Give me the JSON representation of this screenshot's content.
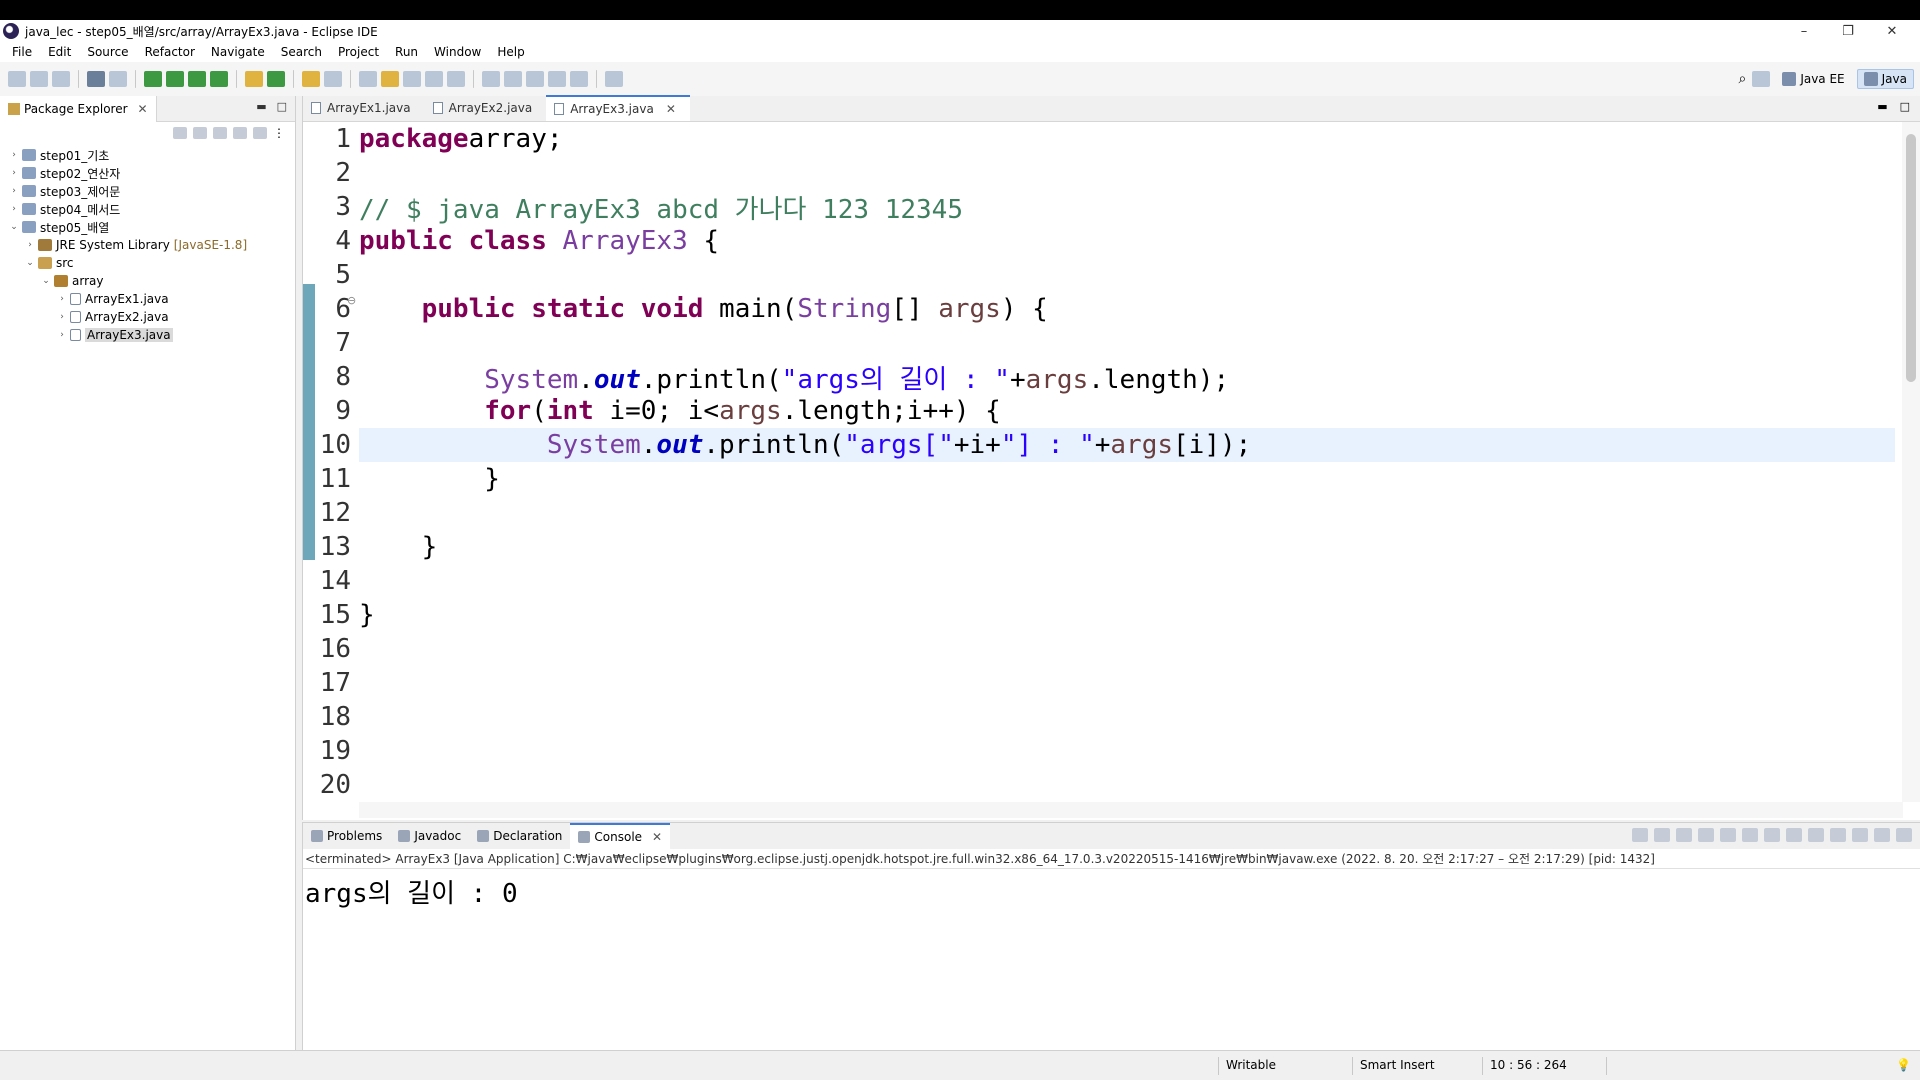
{
  "window": {
    "title": "java_lec - step05_배열/src/array/ArrayEx3.java - Eclipse IDE",
    "minimize": "–",
    "restore": "❐",
    "close": "✕"
  },
  "menu": [
    "File",
    "Edit",
    "Source",
    "Refactor",
    "Navigate",
    "Search",
    "Project",
    "Run",
    "Window",
    "Help"
  ],
  "perspectives": [
    {
      "label": "Java EE",
      "active": false
    },
    {
      "label": "Java",
      "active": true
    }
  ],
  "package_explorer": {
    "title": "Package Explorer",
    "close": "✕",
    "minimize": "▬",
    "maximize": "□",
    "tree": [
      {
        "label": "step01_기초",
        "arrow": "›",
        "icon": "project-icon",
        "indent": 0
      },
      {
        "label": "step02_연산자",
        "arrow": "›",
        "icon": "project-icon",
        "indent": 0
      },
      {
        "label": "step03_제어문",
        "arrow": "›",
        "icon": "project-icon",
        "indent": 0
      },
      {
        "label": "step04_메서드",
        "arrow": "›",
        "icon": "project-icon",
        "indent": 0
      },
      {
        "label": "step05_배열",
        "arrow": "⌄",
        "icon": "project-icon",
        "indent": 0
      },
      {
        "label": "JRE System Library",
        "deco": "[JavaSE-1.8]",
        "arrow": "›",
        "icon": "library-icon",
        "indent": 1
      },
      {
        "label": "src",
        "arrow": "⌄",
        "icon": "source-folder-icon",
        "indent": 1
      },
      {
        "label": "array",
        "arrow": "⌄",
        "icon": "package-icon",
        "indent": 2
      },
      {
        "label": "ArrayEx1.java",
        "arrow": "›",
        "icon": "java-file-icon",
        "indent": 3
      },
      {
        "label": "ArrayEx2.java",
        "arrow": "›",
        "icon": "java-file-icon",
        "indent": 3
      },
      {
        "label": "ArrayEx3.java",
        "arrow": "›",
        "icon": "java-file-icon",
        "indent": 3,
        "selected": true
      }
    ]
  },
  "editor": {
    "tabs": [
      {
        "label": "ArrayEx1.java",
        "active": false
      },
      {
        "label": "ArrayEx2.java",
        "active": false
      },
      {
        "label": "ArrayEx3.java",
        "active": true,
        "close": "✕"
      }
    ],
    "minimize": "▬",
    "maximize": "□",
    "fold_marker": "⊖",
    "current_line": 10,
    "lines": [
      {
        "n": "1",
        "tokens": [
          [
            "kw",
            "package"
          ],
          [
            "",
            "array;"
          ]
        ]
      },
      {
        "n": "2",
        "tokens": []
      },
      {
        "n": "3",
        "tokens": [
          [
            "cm",
            "// $ java ArrayEx3 abcd 가나다 123 12345"
          ]
        ]
      },
      {
        "n": "4",
        "tokens": [
          [
            "kw",
            "public"
          ],
          [
            "",
            " "
          ],
          [
            "kw",
            "class"
          ],
          [
            "",
            " "
          ],
          [
            "ty",
            "ArrayEx3"
          ],
          [
            "",
            " {"
          ]
        ]
      },
      {
        "n": "5",
        "tokens": []
      },
      {
        "n": "6",
        "tokens": [
          [
            "",
            "    "
          ],
          [
            "kw",
            "public"
          ],
          [
            "",
            " "
          ],
          [
            "kw",
            "static"
          ],
          [
            "",
            " "
          ],
          [
            "kw",
            "void"
          ],
          [
            "",
            " main("
          ],
          [
            "ty",
            "String"
          ],
          [
            "",
            "[] "
          ],
          [
            "va",
            "args"
          ],
          [
            "",
            ") {"
          ]
        ]
      },
      {
        "n": "7",
        "tokens": []
      },
      {
        "n": "8",
        "tokens": [
          [
            "",
            "        "
          ],
          [
            "ty",
            "System"
          ],
          [
            "",
            "."
          ],
          [
            "fd",
            "out"
          ],
          [
            "",
            ".println("
          ],
          [
            "st",
            "\"args의 길이 : \""
          ],
          [
            "",
            "+"
          ],
          [
            "va",
            "args"
          ],
          [
            "",
            ".length);"
          ]
        ]
      },
      {
        "n": "9",
        "tokens": [
          [
            "",
            "        "
          ],
          [
            "kw",
            "for"
          ],
          [
            "",
            "("
          ],
          [
            "kw",
            "int"
          ],
          [
            "",
            " i=0; i<"
          ],
          [
            "va",
            "args"
          ],
          [
            "",
            ".length;i++) {"
          ]
        ]
      },
      {
        "n": "10",
        "tokens": [
          [
            "",
            "            "
          ],
          [
            "ty",
            "System"
          ],
          [
            "",
            "."
          ],
          [
            "fd",
            "out"
          ],
          [
            "",
            ".println("
          ],
          [
            "st",
            "\"args[\""
          ],
          [
            "",
            "+i+"
          ],
          [
            "st",
            "\"] : \""
          ],
          [
            "",
            "+"
          ],
          [
            "va",
            "args"
          ],
          [
            "",
            "[i]);"
          ]
        ]
      },
      {
        "n": "11",
        "tokens": [
          [
            "",
            "        }"
          ]
        ]
      },
      {
        "n": "12",
        "tokens": []
      },
      {
        "n": "13",
        "tokens": [
          [
            "",
            "    }"
          ]
        ]
      },
      {
        "n": "14",
        "tokens": []
      },
      {
        "n": "15",
        "tokens": [
          [
            "",
            "}"
          ]
        ]
      },
      {
        "n": "16",
        "tokens": []
      },
      {
        "n": "17",
        "tokens": []
      },
      {
        "n": "18",
        "tokens": []
      },
      {
        "n": "19",
        "tokens": []
      },
      {
        "n": "20",
        "tokens": []
      }
    ]
  },
  "console": {
    "tabs": [
      {
        "label": "Problems",
        "active": false,
        "icon": "problems-icon"
      },
      {
        "label": "Javadoc",
        "active": false,
        "icon": "javadoc-icon"
      },
      {
        "label": "Declaration",
        "active": false,
        "icon": "declaration-icon"
      },
      {
        "label": "Console",
        "active": true,
        "icon": "console-icon",
        "close": "✕"
      }
    ],
    "status": "<terminated> ArrayEx3 [Java Application] C:₩java₩eclipse₩plugins₩org.eclipse.justj.openjdk.hotspot.jre.full.win32.x86_64_17.0.3.v20220515-1416₩jre₩bin₩javaw.exe  (2022. 8. 20. 오전 2:17:27 – 오전 2:17:29) [pid: 1432]",
    "output": "args의 길이 : 0"
  },
  "statusbar": {
    "mode": "Writable",
    "insert": "Smart Insert",
    "position": "10 : 56 : 264"
  }
}
